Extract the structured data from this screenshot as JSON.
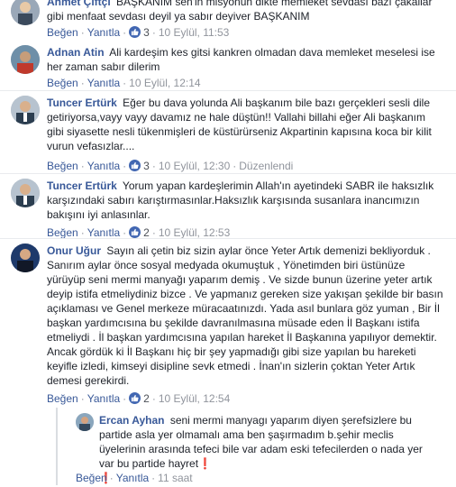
{
  "comments": [
    {
      "author": "Ahmet Çiftçi",
      "text": "BAŞKANIM sen'in misyonun dikte memleket sevdası bazı çakallar gibi menfaat sevdası deyil ya sabır deyiver BAŞKANIM",
      "text_line2": "gibi menfaat sevdası deyil ya sabır deyiver BAŞKANIM",
      "like_label": "Beğen",
      "reply_label": "Yanıtla",
      "likes": "3",
      "time": "10 Eylül, 11:53"
    },
    {
      "author": "Adnan Atin",
      "text": "Ali kardeşim kes gitsi kankren olmadan dava memleket meselesi ise her zaman sabır dilerim",
      "like_label": "Beğen",
      "reply_label": "Yanıtla",
      "time": "10 Eylül, 12:14"
    },
    {
      "author": "Tuncer Ertürk",
      "text": "Eğer bu dava yolunda Ali başkanım bile bazı gerçekleri sesli dile getiriyorsa,vayy vayy davamız ne hale düştün!! Vallahi billahi eğer Ali başkanım gibi siyasette nesli tükenmişleri de küstürürseniz Akpartinin kapısına koca bir kilit vurun vefasızlar....",
      "like_label": "Beğen",
      "reply_label": "Yanıtla",
      "likes": "3",
      "time": "10 Eylül, 12:30",
      "edited": "Düzenlendi"
    },
    {
      "author": "Tuncer Ertürk",
      "text": "Yorum yapan kardeşlerimin Allah'ın ayetindeki SABR ile haksızlık karşızındaki sabırı karıştırmasınlar.Haksızlık karşısında susanlara inancımızın bakışını iyi anlasınlar.",
      "like_label": "Beğen",
      "reply_label": "Yanıtla",
      "likes": "2",
      "time": "10 Eylül, 12:53"
    },
    {
      "author": "Onur Uğur",
      "text": "Sayın ali çetin biz sizin aylar önce Yeter Artık demenizi bekliyorduk . Sanırım aylar önce sosyal medyada okumuştuk , Yönetimden biri üstünüze yürüyüp seni mermi manyağı yaparım demiş . Ve sizde bunun üzerine yeter artık deyip istifa etmeliydiniz bizce . Ve yapmanız gereken size yakışan şekilde bir basın açıklaması ve Genel merkeze müracaatınızdı. Yada asıl bunlara göz yuman , Bir İl başkan yardımcısına bu şekilde davranılmasına müsade eden İl Başkanı istifa etmeliydi . İl başkan yardımcısına yapılan hareket İl Başkanına yapılıyor demektir. Ancak gördük ki İl Başkanı hiç bir şey yapmadığı gibi size yapılan bu hareketi keyifle izledi, kimseyi disipline sevk etmedi . İnan'ın sizlerin çoktan Yeter Artık demesi gerekirdi.",
      "like_label": "Beğen",
      "reply_label": "Yanıtla",
      "likes": "2",
      "time": "10 Eylül, 12:54"
    }
  ],
  "reply": {
    "author": "Ercan Ayhan",
    "text": "seni mermi manyagı yaparım diyen şerefsizlere bu partide asla yer olmamalı ama ben şaşırmadım b.şehir meclis üyelerinin arasında tefeci bile var adam eski tefecilerden o nada yer var bu partide hayret",
    "mark": "❗",
    "like_label": "Beğen",
    "reply_label": "Yanıtla",
    "time": "11 saat"
  },
  "colors": {
    "link": "#385898",
    "meta": "#90949c",
    "like_badge": "#4267b2",
    "divider": "#e9ebee",
    "mark": "#e02020"
  },
  "icons": [
    "avatar",
    "like-thumb-icon",
    "exclamation-mark-icon"
  ]
}
